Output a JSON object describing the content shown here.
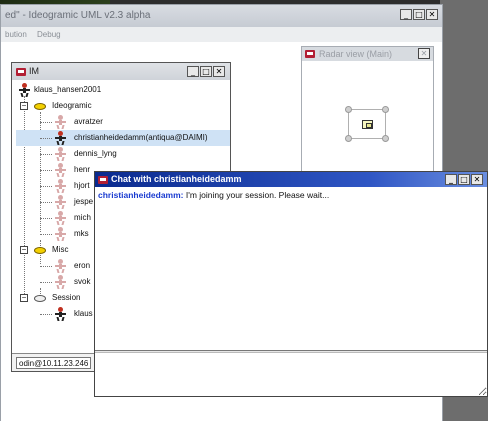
{
  "main_window": {
    "title": "ed\" - Ideogramic UML v2.3 alpha",
    "menu": [
      "bution",
      "Debug"
    ],
    "btn_min": "_",
    "btn_max": "□",
    "btn_close": "✕"
  },
  "radar": {
    "title": "Radar view (Main)",
    "btn_close": "✕"
  },
  "im": {
    "title": "IM",
    "root_user": "klaus_hansen2001",
    "groups": [
      {
        "name": "Ideogramic",
        "expander": "−",
        "members": [
          "avratzer",
          "christianheidedamm(antiqua@DAIMI)",
          "dennis_lyng",
          "henr",
          "hjort",
          "jespe",
          "mich",
          "mks"
        ]
      },
      {
        "name": "Misc",
        "expander": "−",
        "members": [
          "eron",
          "svok"
        ]
      },
      {
        "name": "Session",
        "expander": "−",
        "members": [
          "klaus"
        ]
      }
    ],
    "status": "odin@10.11.23.246"
  },
  "chat": {
    "title": "Chat with christianheidedamm",
    "sender": "christianheidedamm:",
    "message": " I'm joining your session. Please wait...",
    "input_value": ""
  },
  "colors": {
    "chat_title": "#0a2a8e",
    "sender": "#1a3bd0",
    "selected_row": "#cfe2f5"
  }
}
